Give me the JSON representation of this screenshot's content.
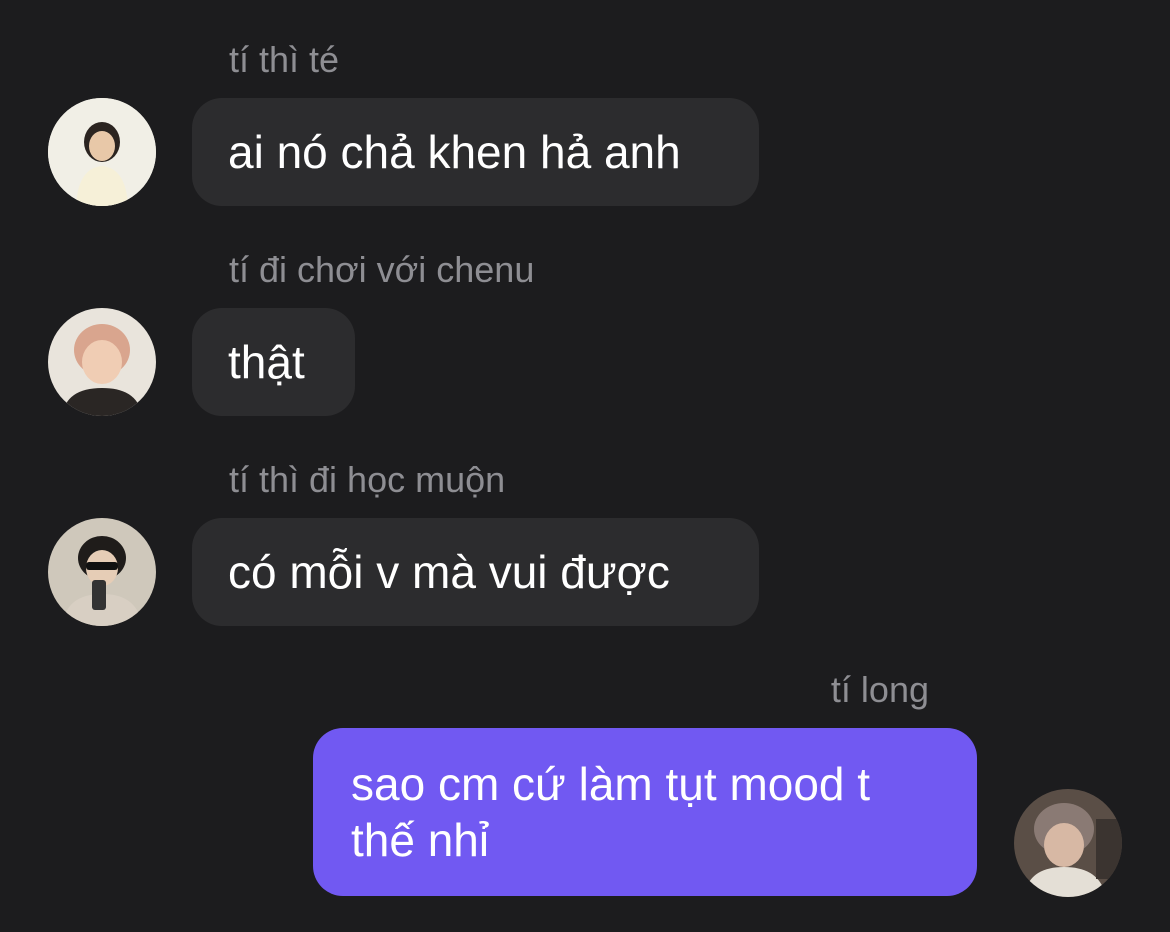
{
  "messages": [
    {
      "sender": "tí thì té",
      "text": "ai nó chả khen hả anh",
      "avatar": "person-avatar-icon",
      "from_me": false
    },
    {
      "sender": "tí đi chơi với chenu",
      "text": "thật",
      "avatar": "person-avatar-icon",
      "from_me": false
    },
    {
      "sender": "tí thì đi học muộn",
      "text": "có mỗi v mà vui được",
      "avatar": "person-avatar-icon",
      "from_me": false
    },
    {
      "sender": "tí long",
      "text": "sao cm cứ làm tụt mood t thế nhỉ",
      "avatar": "person-avatar-icon",
      "from_me": true
    }
  ],
  "colors": {
    "background": "#1c1c1e",
    "incoming_bubble": "#2c2c2e",
    "outgoing_bubble": "#7159f2",
    "sender_name": "#8e8e93",
    "message_text": "#ffffff"
  }
}
